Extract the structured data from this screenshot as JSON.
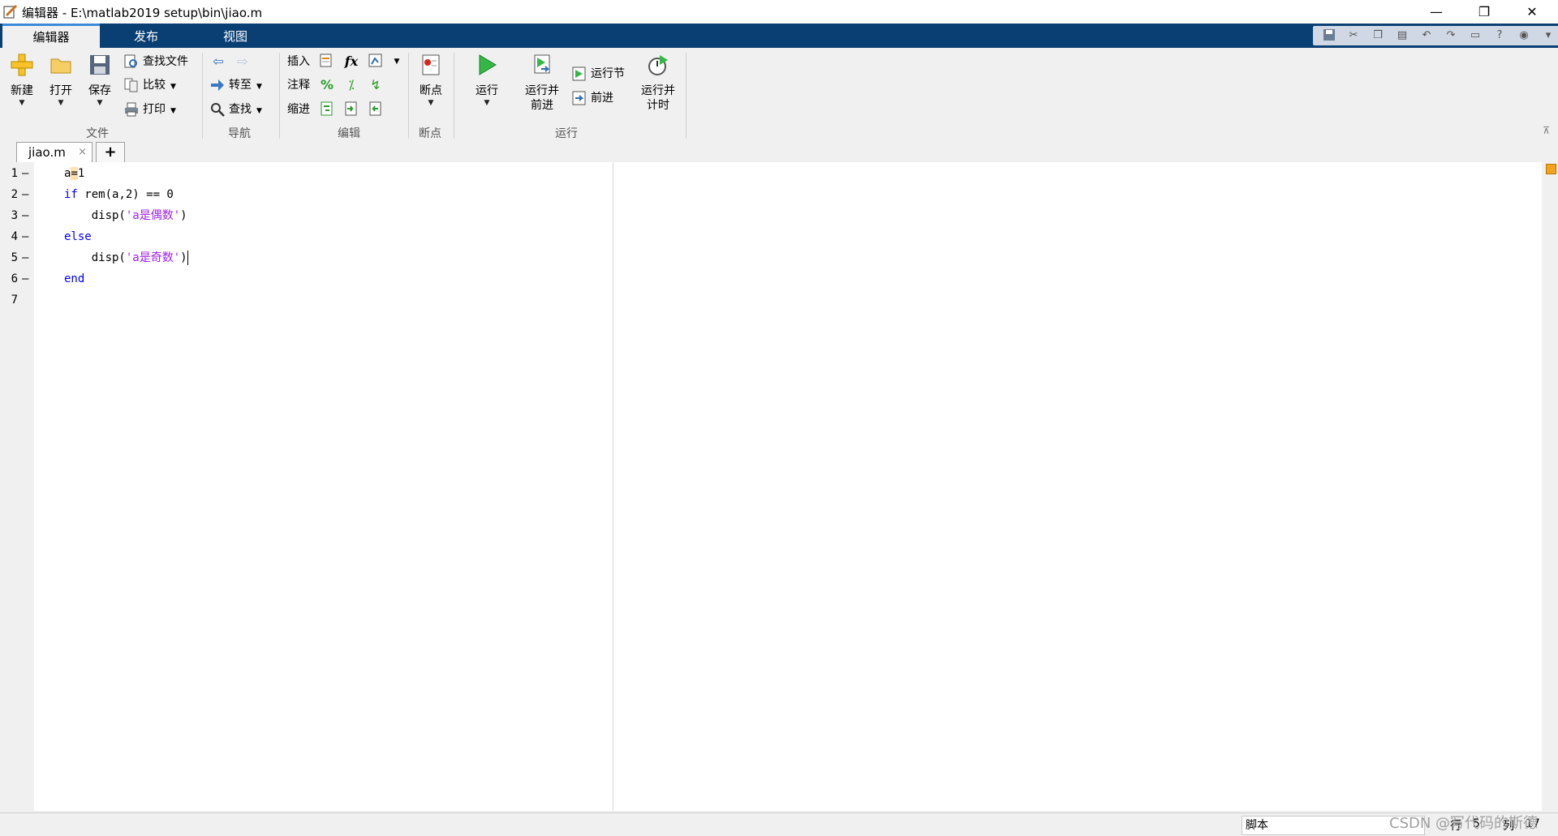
{
  "window": {
    "title": "编辑器 - E:\\matlab2019 setup\\bin\\jiao.m",
    "minimize": "—",
    "restore": "❐",
    "close": "✕"
  },
  "ribbon_tabs": [
    {
      "label": "编辑器",
      "active": true
    },
    {
      "label": "发布",
      "active": false
    },
    {
      "label": "视图",
      "active": false
    }
  ],
  "toolstrip": {
    "file": {
      "section": "文件",
      "new": "新建",
      "open": "打开",
      "save": "保存",
      "find_files": "查找文件",
      "compare": "比较",
      "print": "打印"
    },
    "navigate": {
      "section": "导航",
      "goto": "转至",
      "find": "查找"
    },
    "edit": {
      "section": "编辑",
      "insert": "插入",
      "comment": "注释",
      "indent": "缩进",
      "fx": "fx",
      "percent": "%"
    },
    "breakpoints": {
      "section": "断点",
      "button": "断点"
    },
    "run": {
      "section": "运行",
      "run": "运行",
      "run_advance_1": "运行并",
      "run_advance_2": "前进",
      "run_section": "运行节",
      "advance": "前进",
      "run_time_1": "运行并",
      "run_time_2": "计时"
    }
  },
  "document_tabs": [
    {
      "name": "jiao.m",
      "close": "×"
    }
  ],
  "add_tab": "+",
  "code_lines": [
    {
      "num": "1",
      "marker": "—"
    },
    {
      "num": "2",
      "marker": "—"
    },
    {
      "num": "3",
      "marker": "—"
    },
    {
      "num": "4",
      "marker": "—"
    },
    {
      "num": "5",
      "marker": "—"
    },
    {
      "num": "6",
      "marker": "—"
    },
    {
      "num": "7",
      "marker": ""
    }
  ],
  "code": {
    "l1_a": "a",
    "l1_eq": "=",
    "l1_b": "1",
    "l2_kw": "if",
    "l2_rest": " rem(a,2) == 0",
    "l3_pre": "    disp(",
    "l3_str": "'a是偶数'",
    "l3_post": ")",
    "l4_kw": "else",
    "l5_pre": "    disp(",
    "l5_str": "'a是奇数'",
    "l5_post": ")",
    "l6_kw": "end"
  },
  "status": {
    "mode": "脚本",
    "row_label": "行",
    "row": "5",
    "col_label": "列",
    "col": "17"
  },
  "watermark": "CSDN @写代码的斯德",
  "colors": {
    "tabbar": "#0a3f74",
    "keyword": "#0000ff",
    "string": "#a020f0"
  }
}
